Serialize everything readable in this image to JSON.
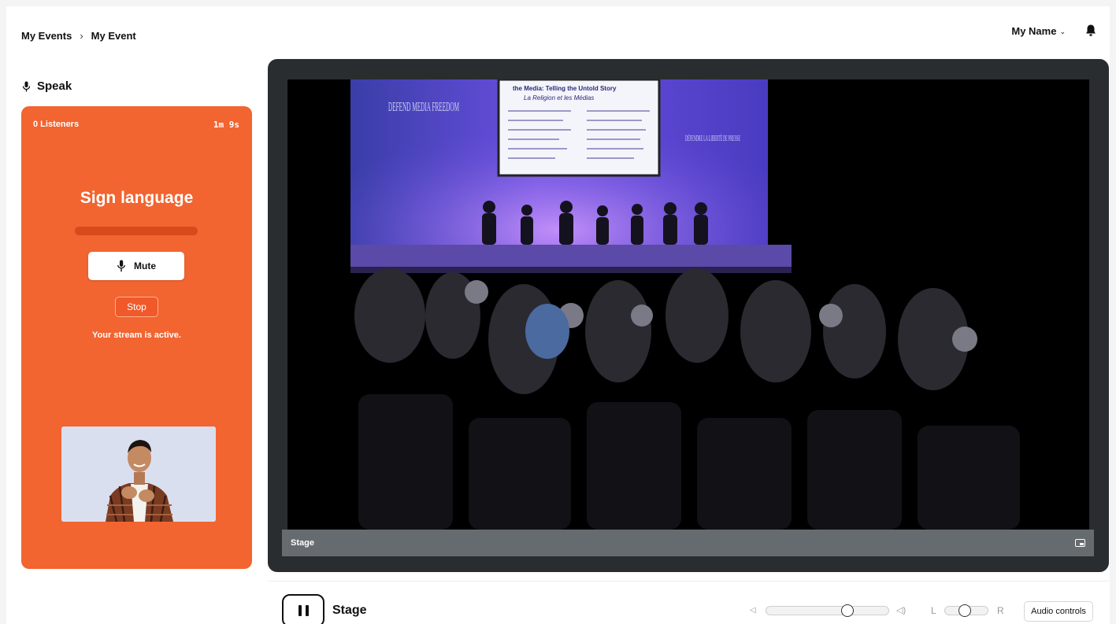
{
  "header": {
    "breadcrumb": [
      "My Events",
      "My Event"
    ],
    "breadcrumb_separator": "›",
    "user_name": "My Name"
  },
  "speak_panel": {
    "title": "Speak",
    "listeners": "0 Listeners",
    "timer": "1m 9s",
    "channel_name": "Sign language",
    "mute_label": "Mute",
    "stop_label": "Stop",
    "status": "Your stream is active.",
    "card_color": "#f26430"
  },
  "stage": {
    "caption": "Stage",
    "video_text": {
      "banner_left": "DEFEND MEDIA FREEDOM",
      "banner_right": "DÉFENDRE LA LIBERTÉ DE PRESSE",
      "screen_title": "the Media: Telling the Untold Story",
      "screen_subtitle": "La Religion et les Médias"
    }
  },
  "player": {
    "title": "Stage",
    "pan_left": "L",
    "pan_right": "R",
    "audio_controls_label": "Audio controls",
    "volume_level": 0.68,
    "pan_balance": 0.45
  },
  "icons": {
    "mic": "mic-icon",
    "bell": "bell-icon",
    "pause": "pause-icon",
    "pip": "picture-in-picture-icon"
  }
}
